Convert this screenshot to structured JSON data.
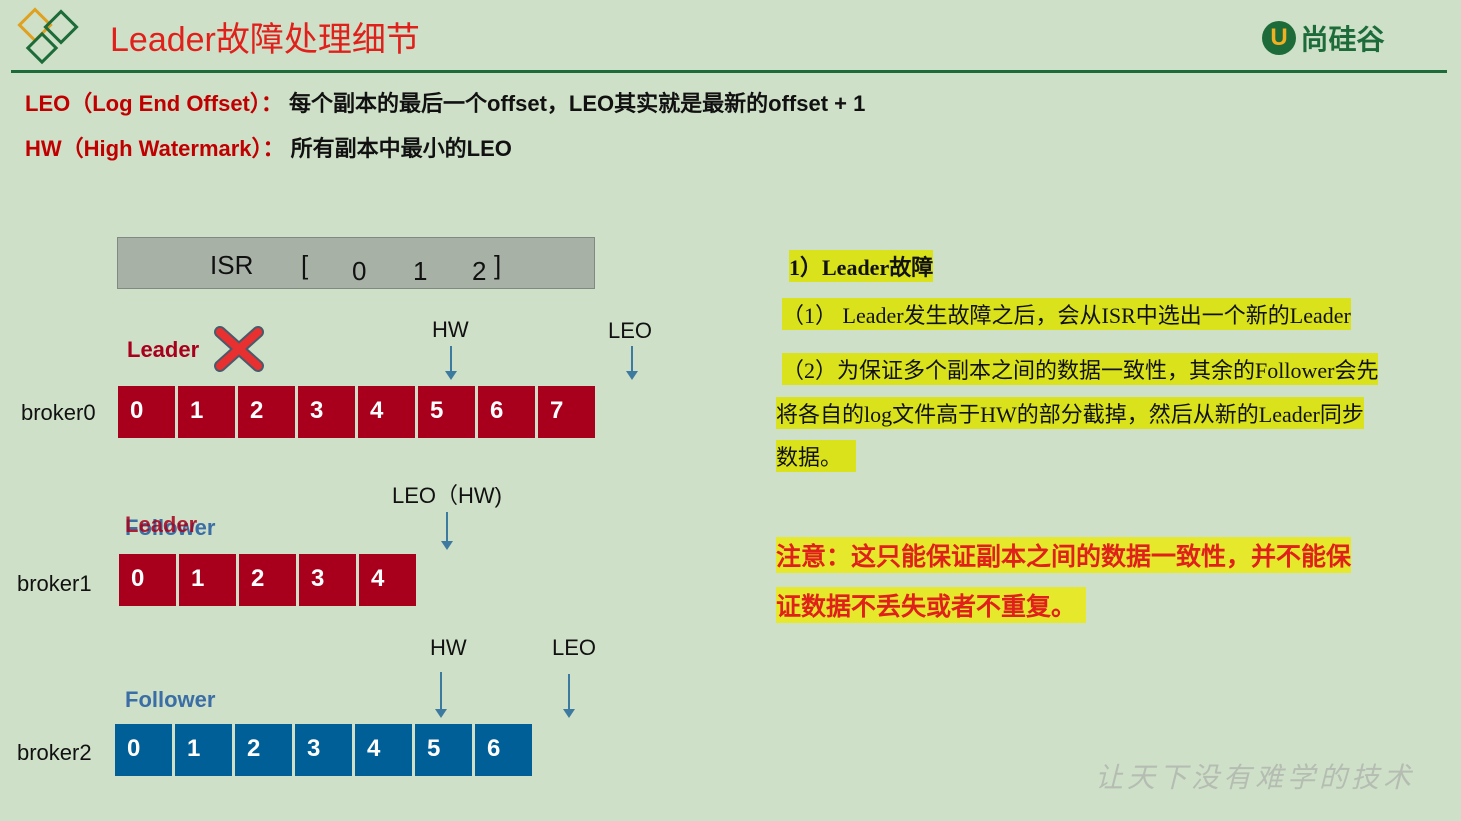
{
  "title": "Leader故障处理细节",
  "brand": "尚硅谷",
  "definitions": [
    {
      "term": "LEO（Log End Offset）：",
      "desc": "每个副本的最后一个offset，LEO其实就是最新的offset + 1"
    },
    {
      "term": "HW（High Watermark）：",
      "desc": "所有副本中最小的LEO"
    }
  ],
  "isr": {
    "label": "ISR",
    "open": "[",
    "members": [
      "0",
      "1",
      "2"
    ],
    "close": "]"
  },
  "brokers": [
    {
      "name": "broker0",
      "role": "Leader",
      "offsets": [
        "0",
        "1",
        "2",
        "3",
        "4",
        "5",
        "6",
        "7"
      ],
      "color": "#a8001c"
    },
    {
      "name": "broker1",
      "role": "Leader",
      "role_overlay": "Follower",
      "offsets": [
        "0",
        "1",
        "2",
        "3",
        "4"
      ],
      "color": "#a8001c"
    },
    {
      "name": "broker2",
      "role": "Follower",
      "offsets": [
        "0",
        "1",
        "2",
        "3",
        "4",
        "5",
        "6"
      ],
      "color": "#005f96"
    }
  ],
  "markers": {
    "b0_hw": "HW",
    "b0_leo": "LEO",
    "b1_leo_hw": "LEO（HW)",
    "b2_hw": "HW",
    "b2_leo": "LEO"
  },
  "notes": {
    "heading": "1）Leader故障",
    "line1": "（1） Leader发生故障之后，会从ISR中选出一个新的Leader",
    "line2a": "（2）为保证多个副本之间的数据一致性，其余的Follower会先",
    "line2b": "将各自的log文件高于HW的部分截掉，然后从新的Leader同步",
    "line2c": "数据。",
    "warn1": "注意：这只能保证副本之间的数据一致性，并不能保",
    "warn2": "证数据不丢失或者不重复。"
  },
  "slogan": "让天下没有难学的技术"
}
